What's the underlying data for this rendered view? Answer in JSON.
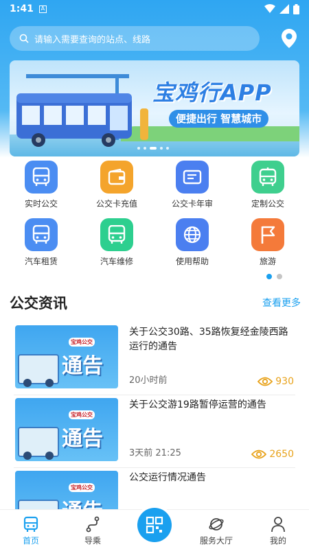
{
  "status": {
    "time": "1:41"
  },
  "search": {
    "placeholder": "请输入需要查询的站点、线路"
  },
  "banner": {
    "title": "宝鸡行APP",
    "subtitle": "便捷出行 智慧城市"
  },
  "grid": [
    {
      "label": "实时公交",
      "icon": "bus-icon",
      "color": "#4b8df2"
    },
    {
      "label": "公交卡充值",
      "icon": "wallet-icon",
      "color": "#f4a42c"
    },
    {
      "label": "公交卡年审",
      "icon": "card-icon",
      "color": "#4b7ff0"
    },
    {
      "label": "定制公交",
      "icon": "custom-bus-icon",
      "color": "#3fcf8e"
    },
    {
      "label": "汽车租赁",
      "icon": "rental-bus-icon",
      "color": "#4b8df2"
    },
    {
      "label": "汽车维修",
      "icon": "repair-bus-icon",
      "color": "#2dcf8f"
    },
    {
      "label": "使用帮助",
      "icon": "globe-icon",
      "color": "#4b7ff0"
    },
    {
      "label": "旅游",
      "icon": "flag-icon",
      "color": "#f47a3a"
    }
  ],
  "section": {
    "title": "公交资讯",
    "more": "查看更多"
  },
  "news": [
    {
      "title": "关于公交30路、35路恢复经金陵西路运行的通告",
      "time": "20小时前",
      "views": "930",
      "thumb_word": "通告",
      "thumb_logo": "宝鸡公交"
    },
    {
      "title": "关于公交游19路暂停运营的通告",
      "time": "3天前  21:25",
      "views": "2650",
      "thumb_word": "通告",
      "thumb_logo": "宝鸡公交"
    },
    {
      "title": "公交运行情况通告",
      "time": "",
      "views": "",
      "thumb_word": "通告",
      "thumb_logo": "宝鸡公交"
    }
  ],
  "tabs": [
    {
      "label": "首页",
      "icon": "home-bus-icon"
    },
    {
      "label": "导乘",
      "icon": "route-icon"
    },
    {
      "label": "服务大厅",
      "icon": "planet-icon"
    },
    {
      "label": "我的",
      "icon": "user-icon"
    }
  ],
  "colors": {
    "accent": "#1aa0ef",
    "views": "#e8a21a"
  }
}
